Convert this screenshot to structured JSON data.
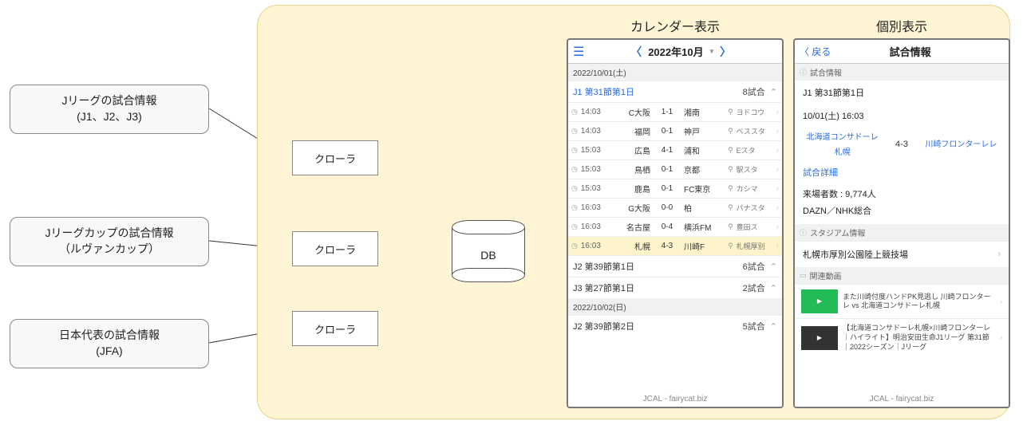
{
  "sources": {
    "s1_line1": "Jリーグの試合情報",
    "s1_line2": "(J1、J2、J3)",
    "s2_line1": "Jリーグカップの試合情報",
    "s2_line2": "（ルヴァンカップ）",
    "s3_line1": "日本代表の試合情報",
    "s3_line2": "(JFA)"
  },
  "crawler_label": "クローラ",
  "db_label": "DB",
  "titles": {
    "calendar": "カレンダー表示",
    "detail": "個別表示"
  },
  "cal": {
    "month_label": "2022年10月",
    "day1": "2022/10/01(土)",
    "node1_title": "J1 第31節第1日",
    "node1_count": "8試合",
    "matches": [
      {
        "time": "14:03",
        "home": "C大阪",
        "score": "1-1",
        "away": "湘南",
        "venue": "ヨドコウ"
      },
      {
        "time": "14:03",
        "home": "福岡",
        "score": "0-1",
        "away": "神戸",
        "venue": "ベススタ"
      },
      {
        "time": "15:03",
        "home": "広島",
        "score": "4-1",
        "away": "浦和",
        "venue": "Eスタ"
      },
      {
        "time": "15:03",
        "home": "鳥栖",
        "score": "0-1",
        "away": "京都",
        "venue": "駅スタ"
      },
      {
        "time": "15:03",
        "home": "鹿島",
        "score": "0-1",
        "away": "FC東京",
        "venue": "カシマ"
      },
      {
        "time": "16:03",
        "home": "G大阪",
        "score": "0-0",
        "away": "柏",
        "venue": "パナスタ"
      },
      {
        "time": "16:03",
        "home": "名古屋",
        "score": "0-4",
        "away": "横浜FM",
        "venue": "豊田ス"
      },
      {
        "time": "16:03",
        "home": "札幌",
        "score": "4-3",
        "away": "川崎F",
        "venue": "札幌厚別"
      }
    ],
    "node2_title": "J2 第39節第1日",
    "node2_count": "6試合",
    "node3_title": "J3 第27節第1日",
    "node3_count": "2試合",
    "day2": "2022/10/02(日)",
    "node4_title": "J2 第39節第2日",
    "node4_count": "5試合",
    "footer": "JCAL - fairycat.biz"
  },
  "det": {
    "back": "戻る",
    "title": "試合情報",
    "sub1": "試合情報",
    "node": "J1 第31節第1日",
    "datetime": "10/01(土) 16:03",
    "home_team": "北海道コンサドーレ札幌",
    "score": "4-3",
    "away_team": "川崎フロンターレレ",
    "detail_link": "試合詳細",
    "attendance": "来場者数 :  9,774人",
    "broadcast": "DAZN／NHK総合",
    "sub2": "スタジアム情報",
    "stadium": "札幌市厚別公園陸上競技場",
    "sub3": "関連動画",
    "vid1": "また川崎付度ハンドPK見逃し 川崎フロンターレ vs 北海道コンサドーレ札幌",
    "vid2": "【北海道コンサドーレ札幌×川崎フロンターレ｜ハイライト】明治安田生命J1リーグ 第31節｜2022シーズン｜Jリーグ",
    "footer": "JCAL - fairycat.biz"
  }
}
